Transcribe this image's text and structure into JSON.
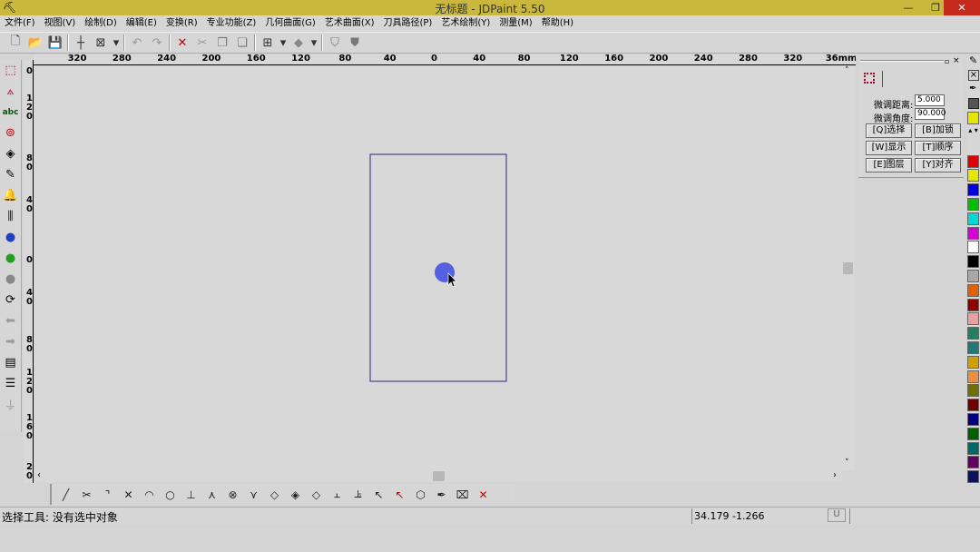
{
  "window": {
    "title": "无标题 - JDPaint 5.50",
    "minimize": "—",
    "restore": "❐",
    "close": "✕"
  },
  "menu": [
    "文件(F)",
    "视图(V)",
    "绘制(D)",
    "编辑(E)",
    "变换(R)",
    "专业功能(Z)",
    "几何曲面(G)",
    "艺术曲面(X)",
    "刀具路径(P)",
    "艺术绘制(Y)",
    "测量(M)",
    "帮助(H)"
  ],
  "toolbar_icons": [
    "new-file",
    "open-folder",
    "save",
    "crosshair",
    "view-box",
    "dropdown",
    "undo",
    "redo",
    "delete",
    "cut",
    "copy",
    "paste",
    "grid-snap",
    "dropdown",
    "shape",
    "dropdown",
    "shield-1",
    "shield-2"
  ],
  "ruler": {
    "h_labels": [
      "320",
      "280",
      "240",
      "200",
      "160",
      "120",
      "80",
      "40",
      "0",
      "40",
      "80",
      "120",
      "160",
      "200",
      "240",
      "280",
      "320",
      "36mm"
    ],
    "v_labels": [
      "0",
      "120",
      "80",
      "40",
      "0",
      "40",
      "80",
      "120",
      "160",
      "20"
    ]
  },
  "left_tools": [
    "select",
    "node-edit",
    "text-abc",
    "offset",
    "fill-shape",
    "eraser",
    "bell",
    "tool-path",
    "bulb-blue",
    "bulb-green",
    "bulb-gray",
    "cycle",
    "arrow-left",
    "arrow-right",
    "layers",
    "lines",
    "plug"
  ],
  "panel": {
    "dist_label": "微调距离:",
    "dist_value": "5.000",
    "angle_label": "微调角度:",
    "angle_value": "90.000",
    "buttons": [
      "[Q]选择",
      "[B]加锁",
      "[W]显示",
      "[T]顺序",
      "[E]图层",
      "[Y]对齐"
    ]
  },
  "palette": [
    "#e6e600",
    "#e00000",
    "#e6e600",
    "#0000e0",
    "#00c000",
    "#00d8d8",
    "#d800d8",
    "#ffffff",
    "#000000",
    "#a8a8a8",
    "#e06000",
    "#900000",
    "#e8a0a0",
    "#208060",
    "#207878",
    "#d0a000",
    "#e89040",
    "#707000",
    "#700000",
    "#000080",
    "#006000",
    "#006868",
    "#600060",
    "#101060"
  ],
  "bottom_tools": [
    "line",
    "trim",
    "corner",
    "cross",
    "arc",
    "circle",
    "perpendicular",
    "tangent",
    "point",
    "node",
    "diamond-1",
    "diamond-2",
    "diamond-3",
    "align-1",
    "align-2",
    "pick-x",
    "pick-red-x",
    "transform",
    "pen",
    "text-edit",
    "delete"
  ],
  "status": {
    "message": "选择工具: 没有选中对象",
    "coords": "34.179 -1.266",
    "unit_btn": "U"
  },
  "canvas": {
    "rect_color": "#2a2a78",
    "cursor_dot_color": "#5560e0"
  }
}
